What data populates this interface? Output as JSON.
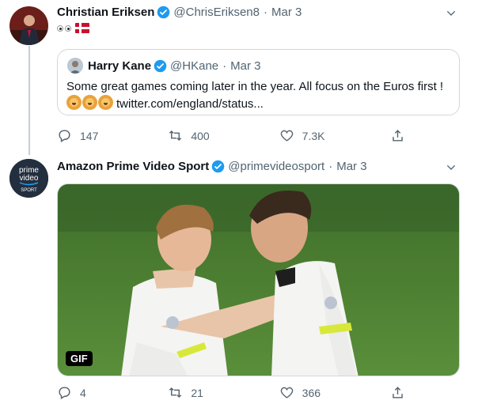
{
  "tweet1": {
    "name": "Christian Eriksen",
    "handle": "@ChrisEriksen8",
    "date": "Mar 3",
    "quote": {
      "name": "Harry Kane",
      "handle": "@HKane",
      "date": "Mar 3",
      "text": "Some great games coming later in the year. All focus on the Euros first !",
      "link": "twitter.com/england/status..."
    },
    "actions": {
      "replies": "147",
      "retweets": "400",
      "likes": "7.3K"
    }
  },
  "tweet2": {
    "name": "Amazon Prime Video Sport",
    "handle": "@primevideosport",
    "date": "Mar 3",
    "avatar_lines": [
      "prime",
      "video",
      "SPORT"
    ],
    "media_badge": "GIF",
    "actions": {
      "replies": "4",
      "retweets": "21",
      "likes": "366"
    }
  },
  "separator": "·",
  "colors": {
    "verified": "#1d9bf0",
    "muted": "#536471",
    "border": "#cfd9de"
  },
  "icons": [
    "verified-badge-icon",
    "chevron-down-icon",
    "reply-icon",
    "retweet-icon",
    "like-icon",
    "share-icon"
  ]
}
